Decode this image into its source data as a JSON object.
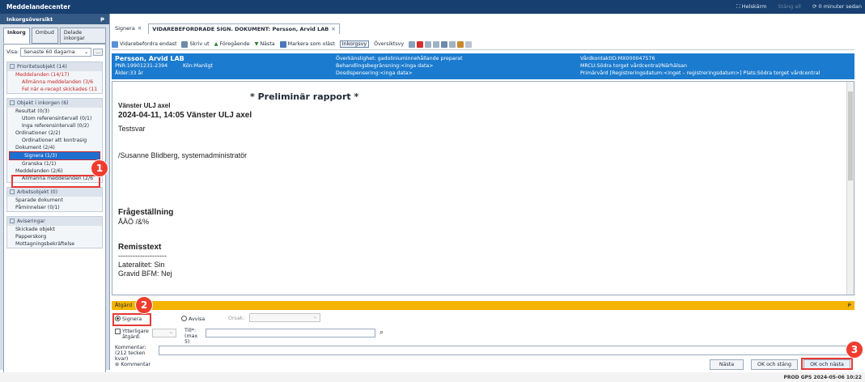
{
  "window": {
    "title": "Meddelandecenter",
    "helskarm": "Helskärm",
    "dim_link": "Stäng all",
    "updated": "0 minuter sedan"
  },
  "left": {
    "header": "Inkorgsöversikt",
    "pin": "ᵽ",
    "tabs": [
      "Inkorg",
      "Ombud",
      "Delade inkorgar"
    ],
    "visa_label": "Visa:",
    "visa_value": "Senaste 60 dagarna",
    "visa_btn": "...",
    "groups": [
      {
        "title": "Prioritetsobjekt (14)",
        "items": []
      },
      {
        "title": "",
        "items": [
          {
            "label": "Meddelanden (14/17)",
            "level": 1,
            "style": "red"
          },
          {
            "label": "Allmänna meddelanden (3/6",
            "level": 2,
            "style": "red"
          },
          {
            "label": "Fel när e-recept skickades (11",
            "level": 2,
            "style": "red"
          }
        ]
      },
      {
        "title": "Objekt i inkorgen (6)",
        "items": []
      },
      {
        "title": "",
        "items": [
          {
            "label": "Resultat (0/3)",
            "level": 1,
            "style": ""
          },
          {
            "label": "Utom referensintervall (0/1)",
            "level": 2,
            "style": ""
          },
          {
            "label": "Inga referensintervall (0/2)",
            "level": 2,
            "style": ""
          },
          {
            "label": "Ordinationer (2/2)",
            "level": 1,
            "style": ""
          },
          {
            "label": "Ordinationer att kontrasig",
            "level": 2,
            "style": ""
          },
          {
            "label": "Dokument (2/4)",
            "level": 1,
            "style": ""
          },
          {
            "label": "Signera (1/3)",
            "level": 2,
            "style": "sel"
          },
          {
            "label": "Granska (1/1)",
            "level": 2,
            "style": ""
          },
          {
            "label": "Meddelanden (2/6)",
            "level": 1,
            "style": ""
          },
          {
            "label": "Allmänna meddelanden (2/6",
            "level": 2,
            "style": ""
          }
        ]
      },
      {
        "title": "Arbetsobjekt (0)",
        "items": [
          {
            "label": "Sparade dokument",
            "level": 1,
            "style": ""
          },
          {
            "label": "Påminnelser (0/1)",
            "level": 1,
            "style": ""
          }
        ]
      },
      {
        "title": "Aviseringar",
        "items": [
          {
            "label": "Skickade objekt",
            "level": 1,
            "style": ""
          },
          {
            "label": "Papperskorg",
            "level": 1,
            "style": ""
          },
          {
            "label": "Mottagningsbekräftelse",
            "level": 1,
            "style": ""
          }
        ]
      }
    ]
  },
  "tabs": {
    "first": "Signera",
    "active": "VIDAREBEFORDRADE SIGN. DOKUMENT: Persson, Arvid LAB",
    "close": "✕"
  },
  "toolbar": {
    "items": [
      "Vidarebefordra endast",
      "Skriv ut",
      "Föregående",
      "Nästa",
      "Markera som oläst",
      "Inkorgsvy",
      "Översiktsvy"
    ]
  },
  "patient": {
    "name": "Persson, Arvid LAB",
    "pnr": "PNR:19901231-2394",
    "kon": "Kön:Manligt",
    "age": "Ålder:33 år",
    "c2": [
      "Överkänslighet: gadoliniuminnehållande preparat",
      "Behandlingsbegränsning:<inga data>",
      "Dosdispensering:<inga data>"
    ],
    "c3": [
      "VårdkontaktID:MX000047576",
      "MRCU:Södra torget vårdcentral/Närhälsan",
      "Primärvård [Registreringsdatum:<inget – registreringsdatum>] Plats:Södra torget vårdcentral"
    ]
  },
  "report": {
    "title": "* Preliminär rapport *",
    "line1": "Vänster ULJ axel",
    "line2": "2024-04-11, 14:05 Vänster ULJ axel",
    "line3": "Testsvar",
    "line4": "/Susanne Blidberg, systemadministratör",
    "h1": "Frågeställning",
    "t1": "ÅÄÖ /&%",
    "h2": "Remisstext",
    "sep": "--------------------",
    "t2": "Lateralitet: Sin",
    "t3": "Gravid BFM: Nej"
  },
  "action": {
    "header": "Åtgärd",
    "signera": "Signera",
    "avvisa": "Avvisa",
    "orsak": "Orsak:",
    "ytterligare": "Ytterligare åtgärd:",
    "till": "Till*: (max 5)",
    "kommentar_label": "Kommentar: (212 tecken kvar)",
    "kommentar_link": "Kommentar",
    "nasta": "Nästa",
    "ok_stang": "OK och stäng",
    "ok_nasta": "OK och nästa"
  },
  "badges": [
    "1",
    "2",
    "3"
  ],
  "status": "PROD  GPS  2024-05-06  10:22"
}
